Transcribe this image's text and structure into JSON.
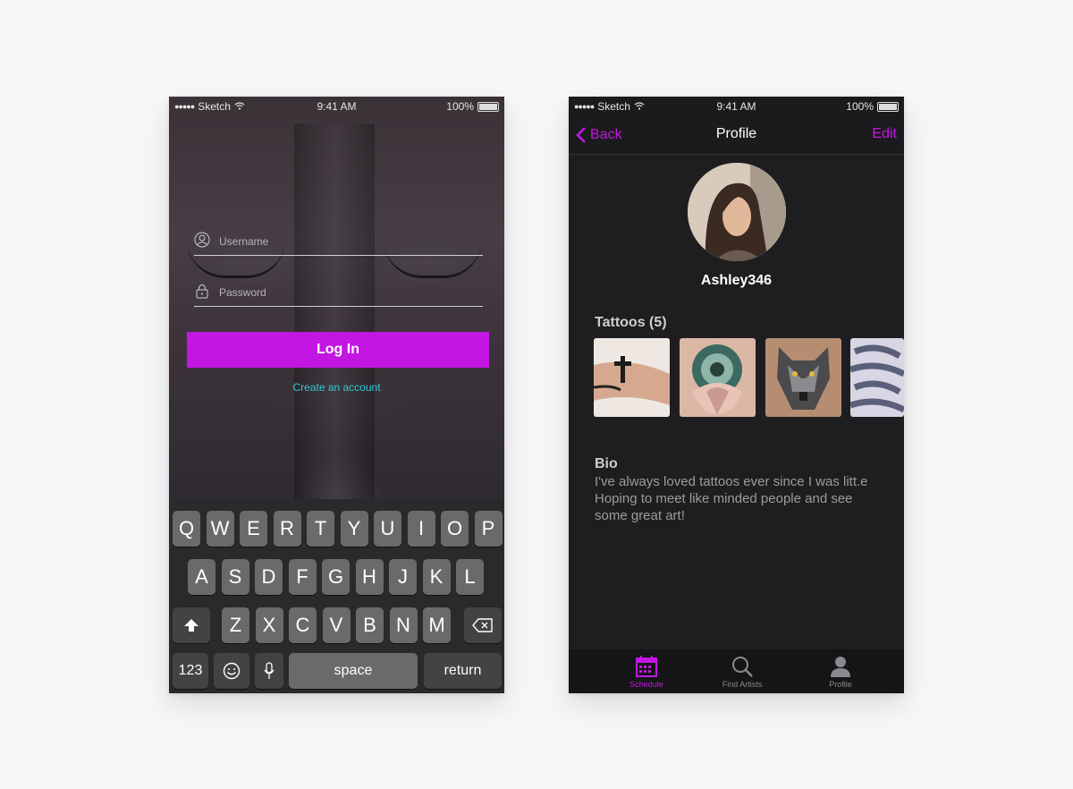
{
  "status": {
    "carrier": "Sketch",
    "time": "9:41 AM",
    "battery": "100%"
  },
  "login": {
    "username_placeholder": "Username",
    "password_placeholder": "Password",
    "login_button": "Log In",
    "create_account": "Create an account"
  },
  "keyboard": {
    "row1": [
      "Q",
      "W",
      "E",
      "R",
      "T",
      "Y",
      "U",
      "I",
      "O",
      "P"
    ],
    "row2": [
      "A",
      "S",
      "D",
      "F",
      "G",
      "H",
      "J",
      "K",
      "L"
    ],
    "row3": [
      "Z",
      "X",
      "C",
      "V",
      "B",
      "N",
      "M"
    ],
    "numbers": "123",
    "space": "space",
    "return": "return"
  },
  "profile": {
    "back": "Back",
    "title": "Profile",
    "edit": "Edit",
    "username": "Ashley346",
    "tattoos_heading": "Tattoos (5)",
    "bio_heading": "Bio",
    "bio_text": "I've always loved tattoos ever since I was litt.e Hoping to meet like minded people and see some great art!"
  },
  "tabbar": {
    "items": [
      {
        "label": "Schedule",
        "icon": "calendar-icon",
        "active": true
      },
      {
        "label": "Find Artists",
        "icon": "search-icon",
        "active": false
      },
      {
        "label": "Profile",
        "icon": "person-icon",
        "active": false
      }
    ]
  },
  "colors": {
    "accent": "#c316e3",
    "link": "#33c9d6"
  }
}
